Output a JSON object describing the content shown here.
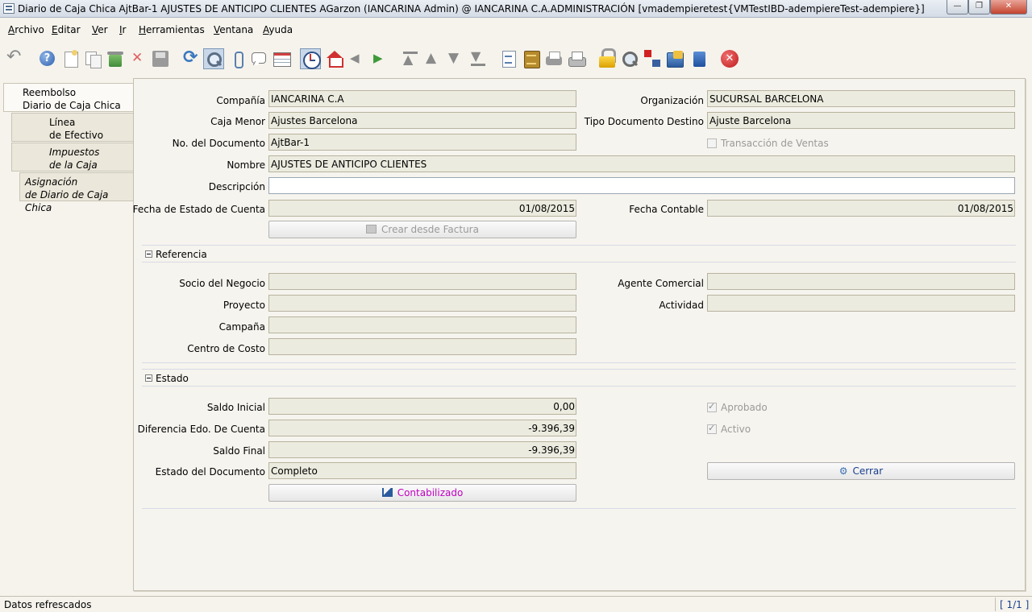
{
  "window": {
    "title": "Diario de Caja Chica  AjtBar-1  AJUSTES DE ANTICIPO CLIENTES  AGarzon (IANCARINA Admin) @ IANCARINA C.A.ADMINISTRACIÓN [vmadempieretest{VMTestIBD-adempiereTest-adempiere}]",
    "min_symbol": "—",
    "max_symbol": "❐",
    "close_symbol": "✕"
  },
  "menu": {
    "items": [
      "Archivo",
      "Editar",
      "Ver",
      "Ir",
      "Herramientas",
      "Ventana",
      "Ayuda"
    ]
  },
  "toolbar": {
    "icons": [
      "undo-icon",
      "help-icon",
      "new-record-icon",
      "copy-record-icon",
      "delete-selection-icon",
      "delete-icon",
      "save-icon",
      "refresh-icon",
      "find-icon",
      "attachment-icon",
      "chat-icon",
      "grid-toggle-icon",
      "history-icon",
      "home-icon",
      "previous-icon",
      "next-icon",
      "first-record-icon",
      "previous-record-icon",
      "next-record-icon",
      "last-record-icon",
      "report-icon",
      "archive-icon",
      "print-preview-icon",
      "print-icon",
      "lock-icon",
      "zoom-across-icon",
      "workflow-icon",
      "process-icon",
      "product-info-icon",
      "exit-icon"
    ]
  },
  "tabs": [
    {
      "line1": "Reembolso",
      "line2": "Diario de Caja Chica",
      "selected": true
    },
    {
      "line1": "Línea",
      "line2": "de Efectivo",
      "selected": false
    },
    {
      "line1": "Impuestos",
      "line2": "de la Caja",
      "selected": false
    },
    {
      "line1": "Asignación",
      "line2": "de Diario de Caja Chica",
      "selected": false
    }
  ],
  "form": {
    "compania": {
      "label": "Compañía",
      "value": "IANCARINA C.A"
    },
    "organizacion": {
      "label": "Organización",
      "value": "SUCURSAL BARCELONA"
    },
    "caja_menor": {
      "label": "Caja Menor",
      "value": "Ajustes Barcelona"
    },
    "tipo_documento_destino": {
      "label": "Tipo Documento Destino",
      "value": "Ajuste Barcelona"
    },
    "no_documento": {
      "label": "No. del Documento",
      "value": "AjtBar-1"
    },
    "transaccion_ventas": {
      "label": "Transacción de Ventas",
      "checked": false
    },
    "nombre": {
      "label": "Nombre",
      "value": "AJUSTES DE ANTICIPO CLIENTES"
    },
    "descripcion": {
      "label": "Descripción",
      "value": ""
    },
    "fecha_estado_cuenta": {
      "label": "Fecha de Estado de Cuenta",
      "value": "01/08/2015"
    },
    "fecha_contable": {
      "label": "Fecha Contable",
      "value": "01/08/2015"
    },
    "crear_desde_factura": {
      "label": "Crear desde Factura"
    }
  },
  "referencia": {
    "title": "Referencia",
    "socio_negocio": {
      "label": "Socio del Negocio",
      "value": ""
    },
    "agente_comercial": {
      "label": "Agente Comercial",
      "value": ""
    },
    "proyecto": {
      "label": "Proyecto",
      "value": ""
    },
    "actividad": {
      "label": "Actividad",
      "value": ""
    },
    "campana": {
      "label": "Campaña",
      "value": ""
    },
    "centro_costo": {
      "label": "Centro de Costo",
      "value": ""
    }
  },
  "estado": {
    "title": "Estado",
    "saldo_inicial": {
      "label": "Saldo Inicial",
      "value": "0,00"
    },
    "aprobado": {
      "label": "Aprobado",
      "checked": true
    },
    "diferencia": {
      "label": "Diferencia Edo. De Cuenta",
      "value": "-9.396,39"
    },
    "activo": {
      "label": "Activo",
      "checked": true
    },
    "saldo_final": {
      "label": "Saldo Final",
      "value": "-9.396,39"
    },
    "estado_documento": {
      "label": "Estado del Documento",
      "value": "Completo"
    },
    "cerrar": {
      "label": "Cerrar"
    },
    "contabilizado": {
      "label": "Contabilizado",
      "color": "#c000c0"
    }
  },
  "status": {
    "message": "Datos refrescados",
    "record": "[ 1/1 ]"
  },
  "colors": {
    "field_bg": "#ecebdf",
    "panel_bg": "#f6f4ee",
    "link_blue": "#1a3f8c"
  }
}
